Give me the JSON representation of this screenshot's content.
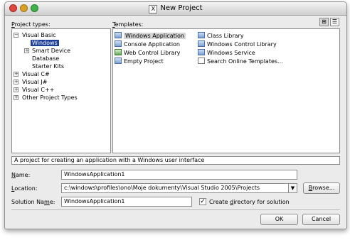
{
  "window": {
    "title": "New Project",
    "title_icon": "X"
  },
  "project_types": {
    "label_pre": "",
    "label_ul": "P",
    "label_post": "roject types:",
    "items": [
      {
        "label": "Visual Basic",
        "expander": "−"
      },
      {
        "label": "Windows"
      },
      {
        "label": "Smart Device",
        "expander": "+"
      },
      {
        "label": "Database"
      },
      {
        "label": "Starter Kits"
      },
      {
        "label": "Visual C#",
        "expander": "+"
      },
      {
        "label": "Visual J#",
        "expander": "+"
      },
      {
        "label": "Visual C++",
        "expander": "+"
      },
      {
        "label": "Other Project Types",
        "expander": "+"
      }
    ]
  },
  "templates": {
    "label_pre": "",
    "label_ul": "T",
    "label_post": "emplates:",
    "items": [
      {
        "label": "Windows Application"
      },
      {
        "label": "Console Application"
      },
      {
        "label": "Web Control Library"
      },
      {
        "label": "Empty Project"
      },
      {
        "label": "Class Library"
      },
      {
        "label": "Windows Control Library"
      },
      {
        "label": "Windows Service"
      },
      {
        "label": "Search Online Templates..."
      }
    ]
  },
  "description": "A project for creating an application with a Windows user interface",
  "name_field": {
    "label_pre": "",
    "label_ul": "N",
    "label_post": "ame:",
    "value": "WindowsApplication1"
  },
  "location_field": {
    "label_pre": "",
    "label_ul": "L",
    "label_post": "ocation:",
    "value": "c:\\windows\\profiles\\ono\\Moje dokumenty\\Visual Studio 2005\\Projects"
  },
  "solution_field": {
    "label_pre": "Solution Na",
    "label_ul": "m",
    "label_post": "e:",
    "value": "WindowsApplication1"
  },
  "browse_button": {
    "pre": "",
    "ul": "B",
    "post": "rowse..."
  },
  "create_dir": {
    "pre": "Create ",
    "ul": "d",
    "post": "irectory for solution",
    "checked_glyph": "✓"
  },
  "ok_label": "OK",
  "cancel_label": "Cancel",
  "view_buttons": {
    "large_icons_glyph": "⊞",
    "small_icons_glyph": "☰"
  }
}
